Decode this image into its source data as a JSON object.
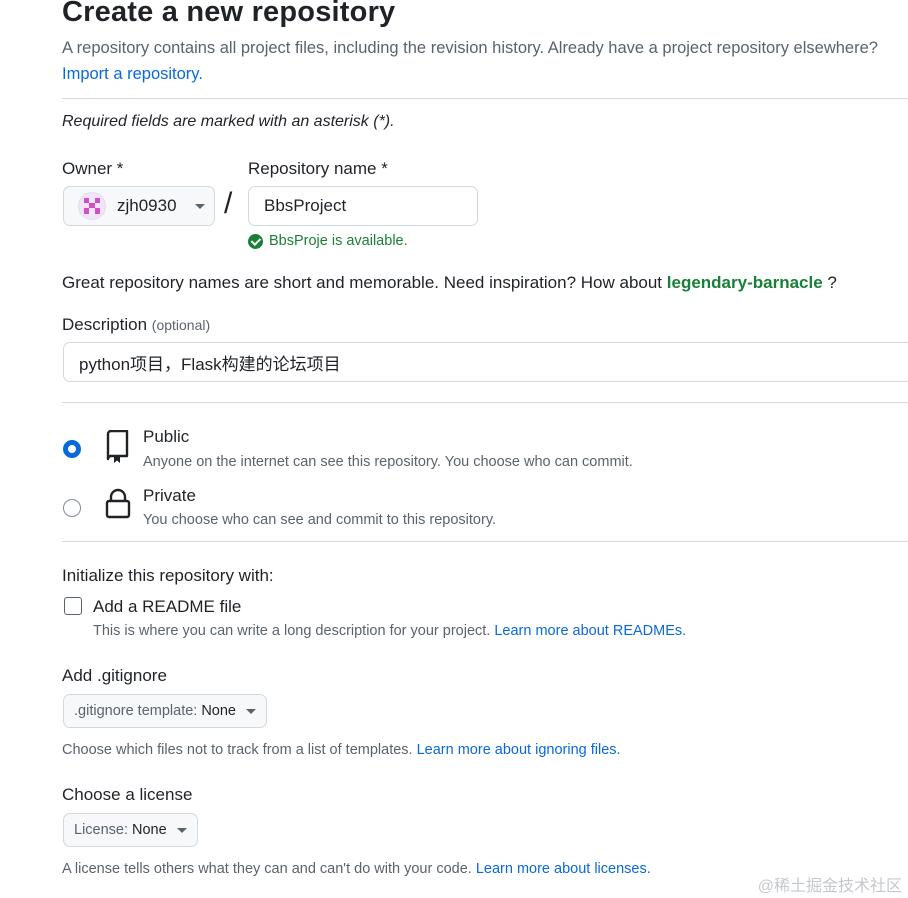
{
  "header": {
    "title": "Create a new repository",
    "intro": "A repository contains all project files, including the revision history. Already have a project repository elsewhere?",
    "import_link": "Import a repository."
  },
  "required_note": "Required fields are marked with an asterisk (*).",
  "owner": {
    "label": "Owner *",
    "value": "zjh0930"
  },
  "separator": "/",
  "repo_name": {
    "label": "Repository name *",
    "value": "BbsProject",
    "availability": "BbsProje is available."
  },
  "suggestion": {
    "prefix": "Great repository names are short and memorable. Need inspiration? How about",
    "name": "legendary-barnacle",
    "suffix": "?"
  },
  "description": {
    "label": "Description",
    "optional": "(optional)",
    "value": "python项目，Flask构建的论坛项目"
  },
  "visibility": {
    "public": {
      "title": "Public",
      "desc": "Anyone on the internet can see this repository. You choose who can commit.",
      "selected": true
    },
    "private": {
      "title": "Private",
      "desc": "You choose who can see and commit to this repository.",
      "selected": false
    }
  },
  "init": {
    "heading": "Initialize this repository with:",
    "readme_label": "Add a README file",
    "readme_desc": "This is where you can write a long description for your project.",
    "readme_link": "Learn more about READMEs."
  },
  "gitignore": {
    "heading": "Add .gitignore",
    "button_prefix": ".gitignore template:",
    "button_value": "None",
    "help": "Choose which files not to track from a list of templates.",
    "help_link": "Learn more about ignoring files."
  },
  "license": {
    "heading": "Choose a license",
    "button_prefix": "License:",
    "button_value": "None",
    "help": "A license tells others what they can and can't do with your code.",
    "help_link": "Learn more about licenses."
  },
  "watermark": "@稀土掘金技术社区",
  "colors": {
    "accent_blue": "#0969da",
    "success_green": "#1a7f37",
    "muted_text": "#59636e",
    "border": "#d1d9e0"
  }
}
